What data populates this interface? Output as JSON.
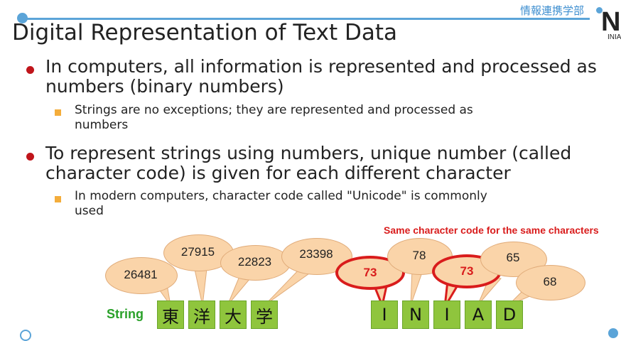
{
  "header": {
    "title": "Digital Representation of Text Data",
    "department": "情報連携学部",
    "logo_letter": "N",
    "logo_text": "INIA"
  },
  "bullets": [
    {
      "text_line1": "In computers, all information is represented and processed as",
      "text_line2": "numbers (binary numbers)",
      "sub": {
        "line1": "Strings are no exceptions; they are represented and processed as",
        "line2": "numbers"
      }
    },
    {
      "text_line1": "To represent strings using numbers, unique number (called",
      "text_line2": "character code) is given for each different character",
      "sub": {
        "line1": "In modern computers, character code called \"Unicode\" is commonly",
        "line2": "used"
      }
    }
  ],
  "diagram": {
    "string_label": "String",
    "note": "Same character code for the same characters",
    "kanji": {
      "chars": [
        "東",
        "洋",
        "大",
        "学"
      ],
      "codes": [
        "26481",
        "27915",
        "22823",
        "23398"
      ]
    },
    "latin": {
      "chars": [
        "I",
        "N",
        "I",
        "A",
        "D"
      ],
      "codes": [
        "73",
        "78",
        "73",
        "65",
        "68"
      ]
    }
  },
  "colors": {
    "accent_blue": "#5ba4d8",
    "bullet_red": "#c0151b",
    "sub_bullet_orange": "#f4ad3b",
    "block_green": "#8fc53d",
    "bubble_fill": "#fad4a9",
    "highlight_red": "#d91c1c",
    "label_green": "#2aa12a"
  }
}
